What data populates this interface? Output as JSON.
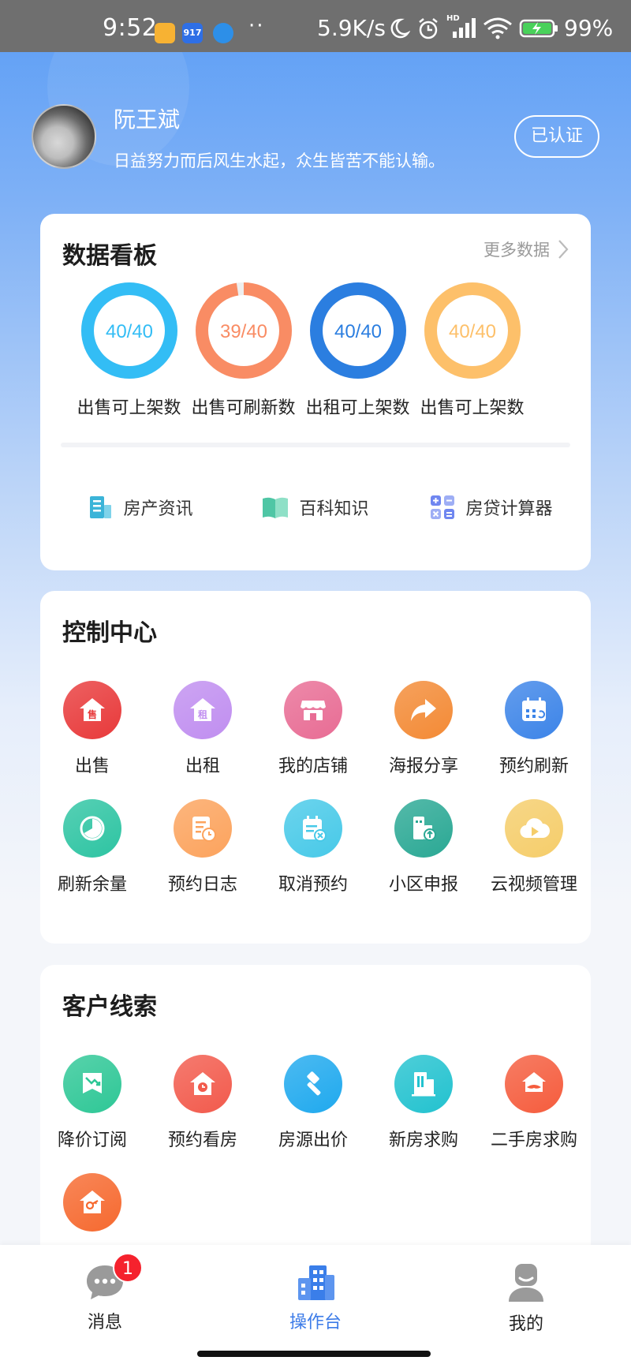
{
  "status_bar": {
    "time": "9:52",
    "apps": [
      "",
      "917",
      ""
    ],
    "dots": "··",
    "net_speed": "5.9K/s",
    "signal_label": "HD",
    "battery": "99%"
  },
  "profile": {
    "name": "阮王斌",
    "motto": "日益努力而后风生水起，众生皆苦不能认输。",
    "verified_label": "已认证"
  },
  "data_board": {
    "title": "数据看板",
    "more_label": "更多数据",
    "rings": [
      {
        "value": "40/40",
        "label": "出售可上架数",
        "color": "#33bdf5",
        "used": 40,
        "total": 40
      },
      {
        "value": "39/40",
        "label": "出售可刷新数",
        "color": "#f98c64",
        "used": 39,
        "total": 40
      },
      {
        "value": "40/40",
        "label": "出租可上架数",
        "color": "#2b7ee0",
        "used": 40,
        "total": 40
      },
      {
        "value": "40/40",
        "label": "出售可上架数",
        "color": "#fdc06a",
        "used": 40,
        "total": 40
      }
    ],
    "tools": [
      {
        "label": "房产资讯",
        "icon": "building-doc-icon",
        "bg": "#eefafb"
      },
      {
        "label": "百科知识",
        "icon": "open-book-icon",
        "bg": "#eefbf8"
      },
      {
        "label": "房贷计算器",
        "icon": "calculator-icon",
        "bg": "#f3f5fe"
      }
    ]
  },
  "control_center": {
    "title": "控制中心",
    "items": [
      {
        "label": "出售",
        "icon": "sell-house-icon",
        "glyph": "售",
        "color": "#e8393a"
      },
      {
        "label": "出租",
        "icon": "rent-house-icon",
        "glyph": "租",
        "color": "#c08ef0"
      },
      {
        "label": "我的店铺",
        "icon": "store-icon",
        "glyph": "",
        "color": "#e86c94"
      },
      {
        "label": "海报分享",
        "icon": "share-arrow-icon",
        "glyph": "",
        "color": "#f38a35"
      },
      {
        "label": "预约刷新",
        "icon": "calendar-refresh-icon",
        "glyph": "",
        "color": "#3c84e8"
      },
      {
        "label": "刷新余量",
        "icon": "pie-chart-icon",
        "glyph": "",
        "color": "#2dc4a2"
      },
      {
        "label": "预约日志",
        "icon": "log-clock-icon",
        "glyph": "",
        "color": "#fca35d"
      },
      {
        "label": "取消预约",
        "icon": "cancel-calendar-icon",
        "glyph": "",
        "color": "#47c9e8"
      },
      {
        "label": "小区申报",
        "icon": "community-upload-icon",
        "glyph": "",
        "color": "#2aa894"
      },
      {
        "label": "云视频管理",
        "icon": "cloud-video-icon",
        "glyph": "",
        "color": "#f5cd6a"
      }
    ]
  },
  "customer_leads": {
    "title": "客户线索",
    "items": [
      {
        "label": "降价订阅",
        "icon": "price-drop-icon",
        "color": "#2ec796"
      },
      {
        "label": "预约看房",
        "icon": "house-clock-icon",
        "color": "#f25a4c"
      },
      {
        "label": "房源出价",
        "icon": "auction-hammer-icon",
        "color": "#1fa9ee"
      },
      {
        "label": "新房求购",
        "icon": "new-building-icon",
        "color": "#22c2cf"
      },
      {
        "label": "二手房求购",
        "icon": "house-hand-icon",
        "color": "#f55c3d"
      },
      {
        "label": "",
        "icon": "house-key-icon",
        "color": "#f6692f"
      }
    ]
  },
  "bottom_nav": {
    "items": [
      {
        "label": "消息",
        "icon": "chat-bubble-icon",
        "badge": "1"
      },
      {
        "label": "操作台",
        "icon": "buildings-icon",
        "badge": ""
      },
      {
        "label": "我的",
        "icon": "user-icon",
        "badge": ""
      }
    ]
  }
}
